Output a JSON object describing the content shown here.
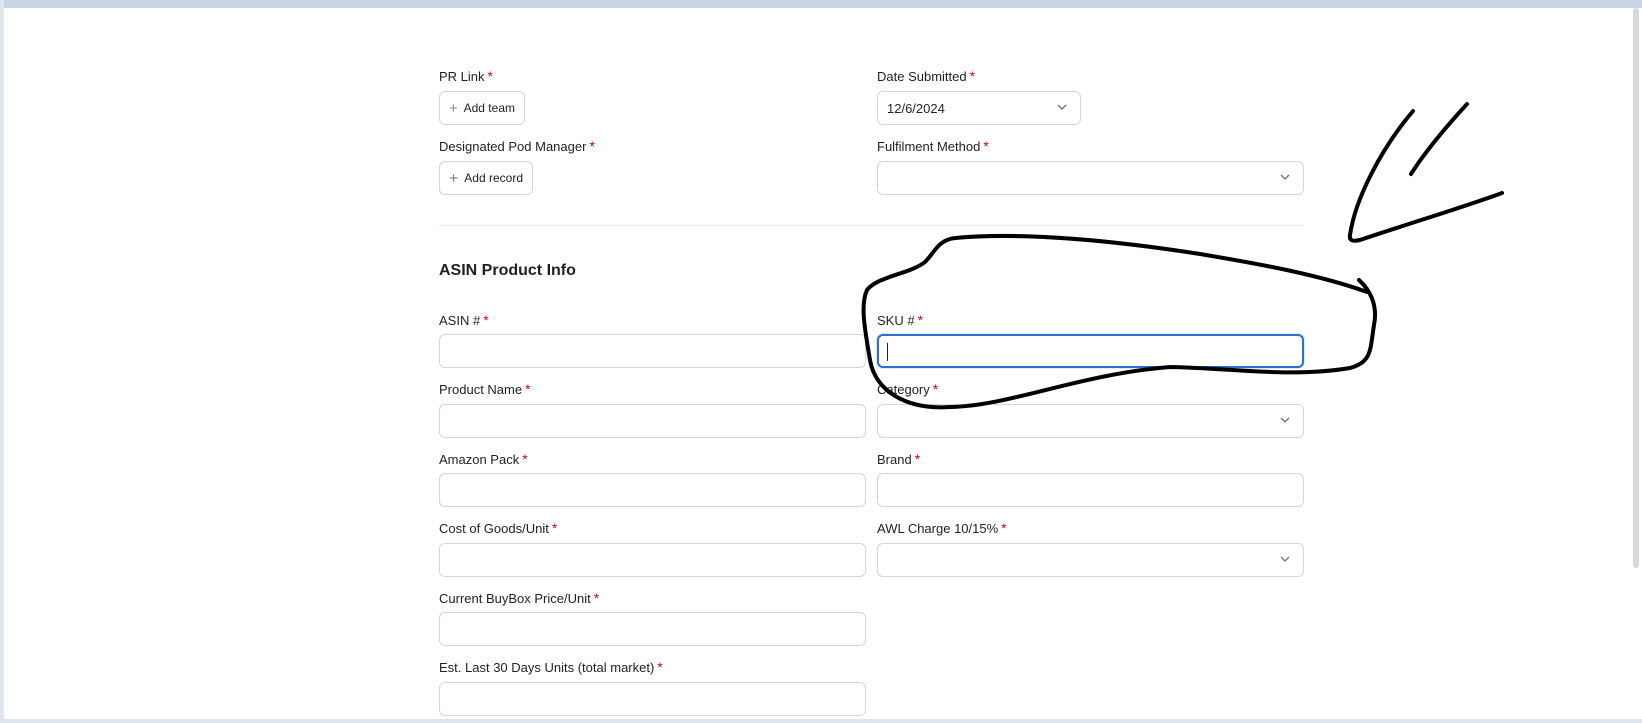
{
  "form": {
    "pr_link": {
      "label": "PR Link",
      "button": "Add team"
    },
    "date_submitted": {
      "label": "Date Submitted",
      "value": "12/6/2024"
    },
    "pod_manager": {
      "label": "Designated Pod Manager",
      "button": "Add record"
    },
    "fulfilment": {
      "label": "Fulfilment Method",
      "value": ""
    },
    "section_title": "ASIN Product Info",
    "asin": {
      "label": "ASIN #",
      "value": ""
    },
    "sku": {
      "label": "SKU #",
      "value": ""
    },
    "product_name": {
      "label": "Product Name",
      "value": ""
    },
    "category": {
      "label": "Category",
      "value": ""
    },
    "amazon_pack": {
      "label": "Amazon Pack",
      "value": ""
    },
    "brand": {
      "label": "Brand",
      "value": ""
    },
    "cost_goods": {
      "label": "Cost of Goods/Unit",
      "value": ""
    },
    "awl_charge": {
      "label": "AWL Charge 10/15%",
      "value": ""
    },
    "buybox": {
      "label": "Current BuyBox Price/Unit",
      "value": ""
    },
    "est_units": {
      "label": "Est. Last 30 Days Units (total market)",
      "value": ""
    },
    "required_marker": "*"
  },
  "icons": {
    "add": "plus-icon",
    "dropdown": "chevron-down-icon"
  },
  "colors": {
    "focus": "#2d6fd3",
    "required": "#d0021b",
    "annotation": "#000000"
  }
}
